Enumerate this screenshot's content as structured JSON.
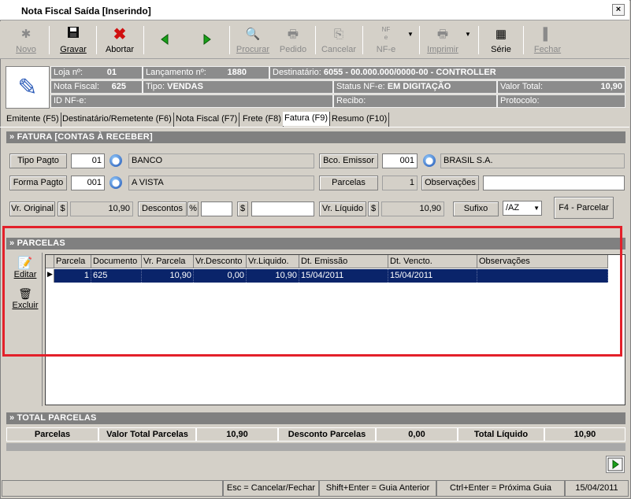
{
  "window": {
    "title": "Nota Fiscal Saída [Inserindo]",
    "close_label": "×"
  },
  "toolbar": {
    "novo": "Novo",
    "gravar": "Gravar",
    "abortar": "Abortar",
    "procurar": "Procurar",
    "pedido": "Pedido",
    "cancelar": "Cancelar",
    "nfe": "NF-e",
    "nfe_small": "NF\ne",
    "imprimir": "Imprimir",
    "serie": "Série",
    "fechar": "Fechar"
  },
  "header": {
    "loja_label": "Loja nº:",
    "loja_value": "01",
    "lancamento_label": "Lançamento nº:",
    "lancamento_value": "1880",
    "destinatario_label": "Destinatário:",
    "destinatario_value": "6055 - 00.000.000/0000-00 - CONTROLLER",
    "nf_label": "Nota Fiscal:",
    "nf_value": "625",
    "tipo_label": "Tipo:",
    "tipo_value": "VENDAS",
    "status_label": "Status NF-e:",
    "status_value": "EM DIGITAÇÃO",
    "valor_label": "Valor Total:",
    "valor_value": "10,90",
    "idnfe_label": "ID NF-e:",
    "recibo_label": "Recibo:",
    "protocolo_label": "Protocolo:"
  },
  "tabs": [
    "Emitente (F5)",
    "Destinatário/Remetente (F6)",
    "Nota Fiscal (F7)",
    "Frete (F8)",
    "Fatura (F9)",
    "Resumo (F10)"
  ],
  "fatura": {
    "section_title": "» FATURA [CONTAS À RECEBER]",
    "tipo_pagto_label": "Tipo Pagto",
    "tipo_pagto_code": "01",
    "tipo_pagto_desc": "BANCO",
    "bco_emissor_label": "Bco. Emissor",
    "bco_emissor_code": "001",
    "bco_emissor_desc": "BRASIL S.A.",
    "forma_pagto_label": "Forma Pagto",
    "forma_pagto_code": "001",
    "forma_pagto_desc": "A VISTA",
    "parcelas_label": "Parcelas",
    "parcelas_value": "1",
    "observacoes_label": "Observações",
    "observacoes_value": "",
    "vr_original_label": "Vr. Original",
    "currency": "$",
    "vr_original_value": "10,90",
    "descontos_label": "Descontos",
    "percent": "%",
    "desconto_pct": "",
    "desconto_val": "",
    "vr_liquido_label": "Vr. Líquido",
    "vr_liquido_value": "10,90",
    "sufixo_label": "Sufixo",
    "sufixo_value": "/AZ",
    "f4_label": "F4 - Parcelar"
  },
  "parcelas": {
    "section_title": "» PARCELAS",
    "editar": "Editar",
    "excluir": "Excluir",
    "columns": [
      "Parcela",
      "Documento",
      "Vr. Parcela",
      "Vr.Desconto",
      "Vr.Liquido.",
      "Dt. Emissão",
      "Dt. Vencto.",
      "Observações"
    ],
    "rows": [
      [
        "1",
        "625",
        "10,90",
        "0,00",
        "10,90",
        "15/04/2011",
        "15/04/2011",
        ""
      ]
    ]
  },
  "totais": {
    "section_title": "» TOTAL PARCELAS",
    "parcelas_label": "Parcelas",
    "valor_total_label": "Valor Total Parcelas",
    "valor_total": "10,90",
    "desconto_label": "Desconto Parcelas",
    "desconto": "0,00",
    "liquido_label": "Total Líquido",
    "liquido": "10,90"
  },
  "statusbar": {
    "esc": "Esc = Cancelar/Fechar",
    "shift": "Shift+Enter = Guia Anterior",
    "ctrl": "Ctrl+Enter = Próxima Guia",
    "date": "15/04/2011"
  }
}
